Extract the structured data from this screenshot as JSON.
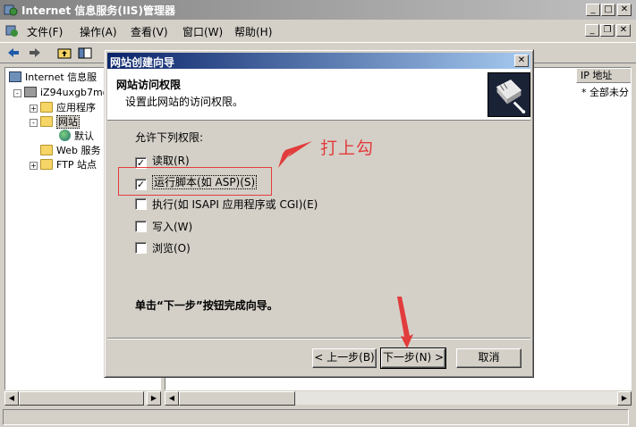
{
  "window": {
    "title": "Internet 信息服务(IIS)管理器",
    "controls": {
      "minimize": "_",
      "maximize": "□",
      "close": "✕"
    }
  },
  "menubar": {
    "items": [
      "文件(F)",
      "操作(A)",
      "查看(V)",
      "窗口(W)",
      "帮助(H)"
    ],
    "mdi_controls": {
      "minimize": "_",
      "restore": "❐",
      "close": "✕"
    }
  },
  "toolbar": {
    "buttons": [
      "back-arrow-icon",
      "forward-arrow-icon",
      "up-folder-icon",
      "show-tree-icon"
    ]
  },
  "tree": {
    "items": [
      {
        "label": "Internet 信息服",
        "icon": "iis-icon",
        "indent": 0
      },
      {
        "label": "iZ94uxgb7mo",
        "icon": "server-icon",
        "indent": 1,
        "expander": "-"
      },
      {
        "label": "应用程序",
        "icon": "folder-icon",
        "indent": 2,
        "expander": "+"
      },
      {
        "label": "网站",
        "icon": "folder-icon",
        "indent": 2,
        "expander": "-"
      },
      {
        "label": "默认",
        "icon": "globe-icon",
        "indent": 3
      },
      {
        "label": "Web 服务",
        "icon": "folder-icon",
        "indent": 2
      },
      {
        "label": "FTP 站点",
        "icon": "folder-icon",
        "indent": 2,
        "expander": "+"
      }
    ]
  },
  "list": {
    "columns": [
      "IP 地址"
    ],
    "cells": [
      "* 全部未分"
    ]
  },
  "dialog": {
    "title": "网站创建向导",
    "header_title": "网站访问权限",
    "header_subtitle": "设置此网站的访问权限。",
    "permissions_label": "允许下列权限:",
    "permissions": [
      {
        "label": "读取(R)",
        "checked": true
      },
      {
        "label": "运行脚本(如 ASP)(S)",
        "checked": true
      },
      {
        "label": "执行(如 ISAPI 应用程序或 CGI)(E)",
        "checked": false
      },
      {
        "label": "写入(W)",
        "checked": false
      },
      {
        "label": "浏览(O)",
        "checked": false
      }
    ],
    "finish_note": "单击“下一步”按钮完成向导。",
    "buttons": {
      "back": "< 上一步(B)",
      "next": "下一步(N) >",
      "cancel": "取消"
    }
  },
  "annotation": {
    "text": "打上勾",
    "color": "#e23c3c"
  }
}
